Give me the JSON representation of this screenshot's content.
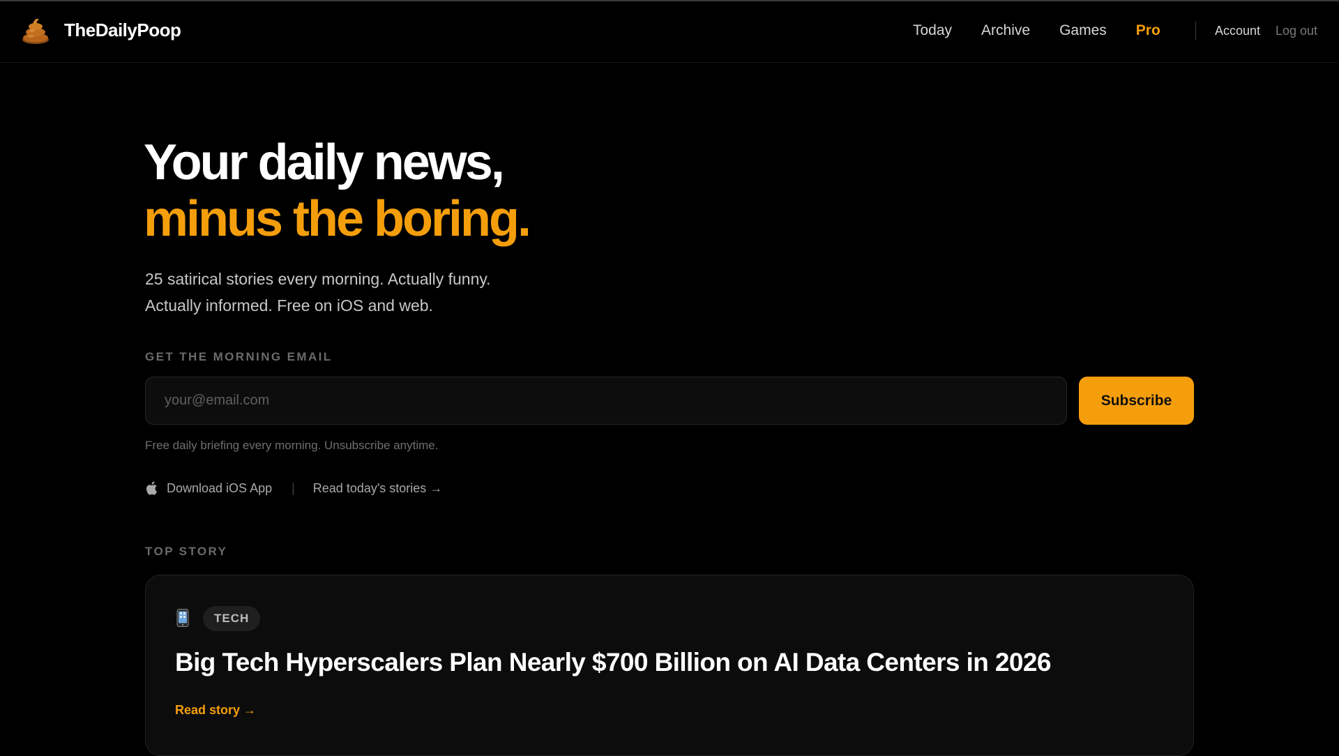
{
  "colors": {
    "accent": "#f59e0b",
    "background": "#000000",
    "card": "#0c0c0c"
  },
  "brand": {
    "name": "TheDailyPoop",
    "icon": "poop-icon"
  },
  "nav": {
    "links": [
      "Today",
      "Archive",
      "Games"
    ],
    "pro_label": "Pro",
    "account_label": "Account",
    "logout_label": "Log out"
  },
  "hero": {
    "line1": "Your daily news,",
    "line2": "minus the boring.",
    "subtitle_line1": "25 satirical stories every morning. Actually funny.",
    "subtitle_line2": "Actually informed. Free on iOS and web."
  },
  "signup": {
    "label": "GET THE MORNING EMAIL",
    "placeholder": "your@email.com",
    "value": "",
    "button_label": "Subscribe",
    "fine_print": "Free daily briefing every morning. Unsubscribe anytime."
  },
  "links": {
    "ios_icon": "apple-icon",
    "ios_label": "Download iOS App",
    "separator": "|",
    "read_label": "Read today's stories →"
  },
  "top_story": {
    "section_label": "TOP STORY",
    "category_icon": "phone-icon",
    "category": "TECH",
    "title": "Big Tech Hyperscalers Plan Nearly $700 Billion on AI Data Centers in 2026",
    "link_label": "Read story →"
  }
}
